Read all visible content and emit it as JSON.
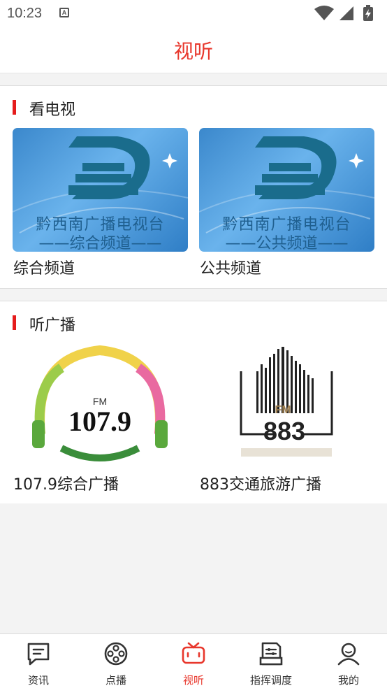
{
  "status_bar": {
    "time": "10:23",
    "notification_glyph": "A",
    "icons": [
      "wifi-icon",
      "signal-icon",
      "battery-charging-icon"
    ]
  },
  "header": {
    "title": "视听"
  },
  "tv_section": {
    "title": "看电视",
    "channels": [
      {
        "name": "综合频道",
        "thumb_line1": "黔西南广播电视台",
        "thumb_line2": "——综合频道——"
      },
      {
        "name": "公共频道",
        "thumb_line1": "黔西南广播电视台",
        "thumb_line2": "——公共频道——"
      }
    ]
  },
  "radio_section": {
    "title": "听广播",
    "stations": [
      {
        "name": "107.9综合广播",
        "logo_text": "107.9",
        "logo_fm": "FM"
      },
      {
        "name": "883交通旅游广播",
        "logo_text": "883",
        "logo_fm": "FM"
      }
    ]
  },
  "tabbar": {
    "active_color": "#e8372c",
    "items": [
      {
        "label": "资讯",
        "icon": "chat-bubble-icon"
      },
      {
        "label": "点播",
        "icon": "film-reel-icon"
      },
      {
        "label": "视听",
        "icon": "tv-icon",
        "active": true
      },
      {
        "label": "指挥调度",
        "icon": "dispatch-doc-icon"
      },
      {
        "label": "我的",
        "icon": "user-icon"
      }
    ]
  }
}
